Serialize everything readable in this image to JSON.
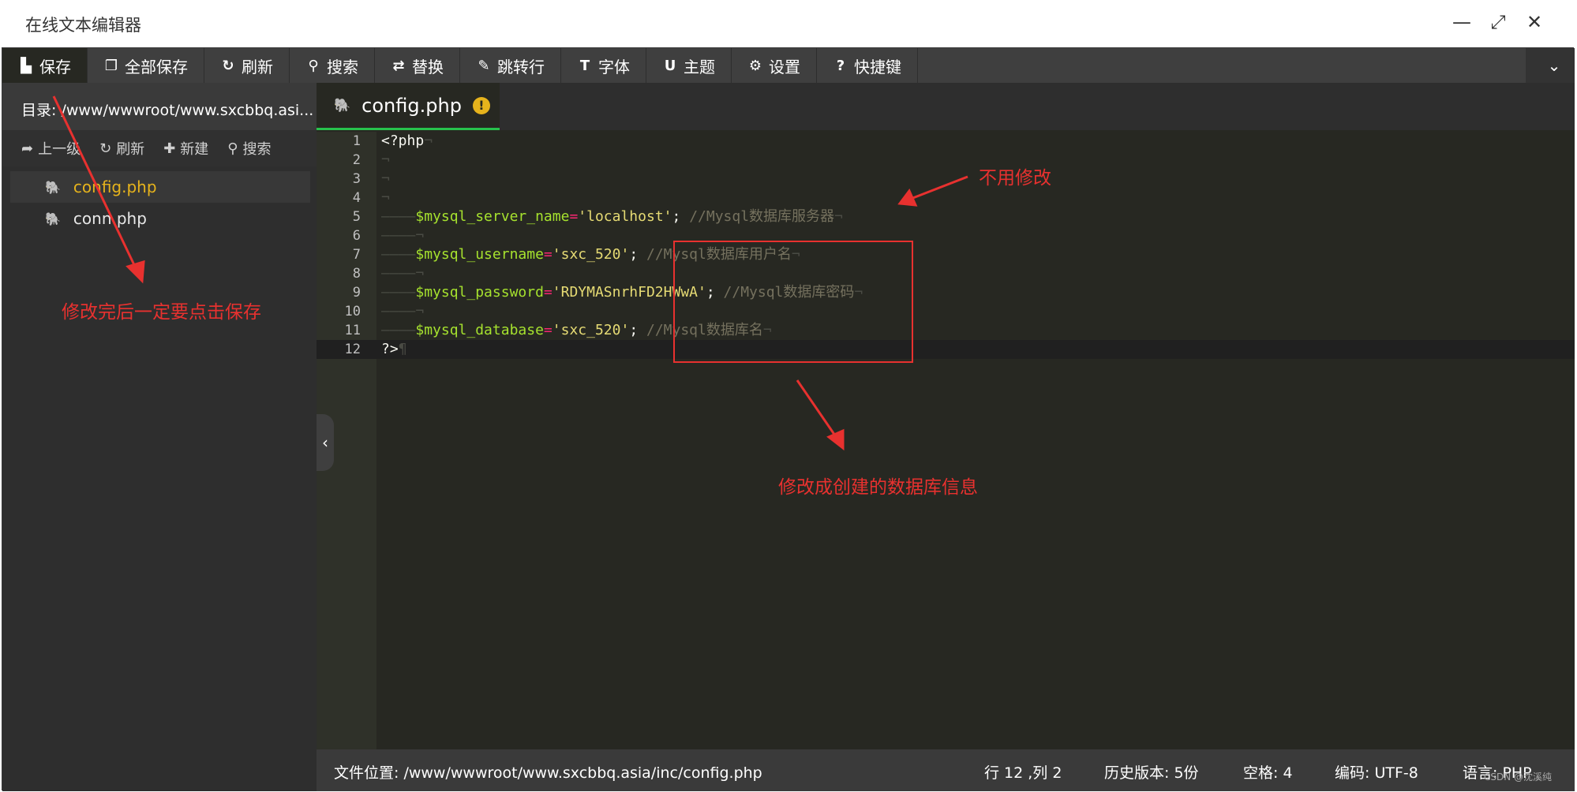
{
  "window": {
    "title": "在线文本编辑器",
    "controls": [
      "minimize-icon",
      "maximize-icon",
      "close-icon"
    ]
  },
  "toolbar": {
    "items": [
      {
        "label": "保存",
        "icon": "save-icon"
      },
      {
        "label": "全部保存",
        "icon": "save-all-icon"
      },
      {
        "label": "刷新",
        "icon": "refresh-icon"
      },
      {
        "label": "搜索",
        "icon": "search-icon"
      },
      {
        "label": "替换",
        "icon": "replace-icon"
      },
      {
        "label": "跳转行",
        "icon": "pin-icon"
      },
      {
        "label": "字体",
        "icon": "font-icon"
      },
      {
        "label": "主题",
        "icon": "magnet-icon"
      },
      {
        "label": "设置",
        "icon": "gear-icon"
      },
      {
        "label": "快捷键",
        "icon": "help-icon"
      }
    ]
  },
  "sidebar": {
    "directory": "目录: /www/wwwroot/www.sxcbbq.asi...",
    "tools": [
      {
        "label": "上一级",
        "icon": "share-icon"
      },
      {
        "label": "刷新",
        "icon": "refresh-icon"
      },
      {
        "label": "新建",
        "icon": "plus-icon"
      },
      {
        "label": "搜索",
        "icon": "search-icon"
      }
    ],
    "files": [
      {
        "name": "config.php",
        "active": true
      },
      {
        "name": "conn.php",
        "active": false
      }
    ]
  },
  "editor": {
    "tab": {
      "label": "config.php",
      "warning": "!"
    },
    "lines": [
      {
        "n": "1",
        "text": "<?php"
      },
      {
        "n": "2",
        "text": ""
      },
      {
        "n": "3",
        "text": ""
      },
      {
        "n": "4",
        "text": ""
      },
      {
        "n": "5",
        "var": "$mysql_server_name",
        "value": "'localhost'",
        "comment": "//Mysql数据库服务器"
      },
      {
        "n": "6",
        "text": ""
      },
      {
        "n": "7",
        "var": "$mysql_username",
        "value": "'sxc_520'",
        "comment": "//Mysql数据库用户名"
      },
      {
        "n": "8",
        "text": ""
      },
      {
        "n": "9",
        "var": "$mysql_password",
        "value": "'RDYMASnrhFD2HWwA'",
        "comment": "//Mysql数据库密码"
      },
      {
        "n": "10",
        "text": ""
      },
      {
        "n": "11",
        "var": "$mysql_database",
        "value": "'sxc_520'",
        "comment": "//Mysql数据库名"
      },
      {
        "n": "12",
        "text": "?>"
      }
    ]
  },
  "statusbar": {
    "file_location": "文件位置: /www/wwwroot/www.sxcbbq.asia/inc/config.php",
    "cursor": "行 12 ,列 2",
    "history": "历史版本: 5份",
    "indent": "空格: 4",
    "encoding": "编码: UTF-8",
    "language": "语言: PHP"
  },
  "annotations": {
    "save_note": "修改完后一定要点击保存",
    "no_change_note": "不用修改",
    "db_info_note": "修改成创建的数据库信息"
  },
  "watermark": "CSDN @沈溪纯",
  "colors": {
    "annotation": "#e8312f",
    "active_file": "#e6b31c",
    "tab_underline": "#27c24c",
    "variable": "#a6e22e",
    "string": "#e6db74",
    "comment": "#75715e"
  }
}
